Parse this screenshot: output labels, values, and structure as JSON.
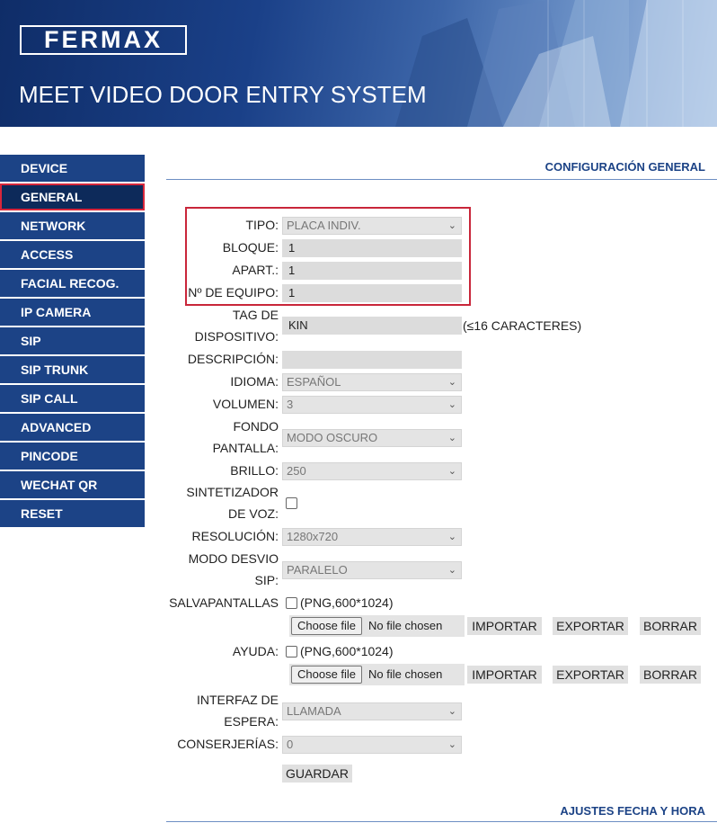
{
  "brand": {
    "logo": "FERMAX",
    "title": "MEET VIDEO DOOR ENTRY SYSTEM"
  },
  "colors": {
    "primary": "#1c4386",
    "active_nav": "#0d2a5a",
    "highlight": "#c9263a"
  },
  "sidebar": {
    "items": [
      {
        "label": "DEVICE"
      },
      {
        "label": "GENERAL"
      },
      {
        "label": "NETWORK"
      },
      {
        "label": "ACCESS"
      },
      {
        "label": "FACIAL RECOG."
      },
      {
        "label": "IP CAMERA"
      },
      {
        "label": "SIP"
      },
      {
        "label": "SIP TRUNK"
      },
      {
        "label": "SIP CALL"
      },
      {
        "label": "ADVANCED"
      },
      {
        "label": "PINCODE"
      },
      {
        "label": "WECHAT QR"
      },
      {
        "label": "RESET"
      }
    ],
    "active": "GENERAL"
  },
  "general": {
    "section_title": "CONFIGURACIÓN GENERAL",
    "tipo": {
      "label": "TIPO:",
      "value": "PLACA INDIV."
    },
    "bloque": {
      "label": "BLOQUE:",
      "value": "1"
    },
    "apart": {
      "label": "APART.:",
      "value": "1"
    },
    "equipo": {
      "label": "Nº DE EQUIPO:",
      "value": "1"
    },
    "tag": {
      "label_line1": "TAG DE",
      "label_line2": "DISPOSITIVO:",
      "value": "KIN",
      "hint": "(≤16 CARACTERES)"
    },
    "descripcion": {
      "label": "DESCRIPCIÓN:",
      "value": ""
    },
    "idioma": {
      "label": "IDIOMA:",
      "value": "ESPAÑOL"
    },
    "volumen": {
      "label": "VOLUMEN:",
      "value": "3"
    },
    "fondo": {
      "label_line1": "FONDO",
      "label_line2": "PANTALLA:",
      "value": "MODO OSCURO"
    },
    "brillo": {
      "label": "BRILLO:",
      "value": "250"
    },
    "sintetizador": {
      "label_line1": "SINTETIZADOR",
      "label_line2": "DE VOZ:",
      "checked": false
    },
    "resolucion": {
      "label": "RESOLUCIÓN:",
      "value": "1280x720"
    },
    "modo_desvio": {
      "label_line1": "MODO DESVIO",
      "label_line2": "SIP:",
      "value": "PARALELO"
    },
    "salvapantallas": {
      "label": "SALVAPANTALLAS",
      "checked": false,
      "hint": "(PNG,600*1024)",
      "choose_file": "Choose file",
      "no_file": "No file chosen",
      "importar": "IMPORTAR",
      "exportar": "EXPORTAR",
      "borrar": "BORRAR"
    },
    "ayuda": {
      "label": "AYUDA:",
      "checked": false,
      "hint": "(PNG,600*1024)",
      "choose_file": "Choose file",
      "no_file": "No file chosen",
      "importar": "IMPORTAR",
      "exportar": "EXPORTAR",
      "borrar": "BORRAR"
    },
    "interfaz": {
      "label_line1": "INTERFAZ DE",
      "label_line2": "ESPERA:",
      "value": "LLAMADA"
    },
    "conserjerias": {
      "label": "CONSERJERÍAS:",
      "value": "0"
    },
    "guardar": "GUARDAR"
  },
  "fecha_hora": {
    "section_title": "AJUSTES FECHA Y HORA"
  }
}
